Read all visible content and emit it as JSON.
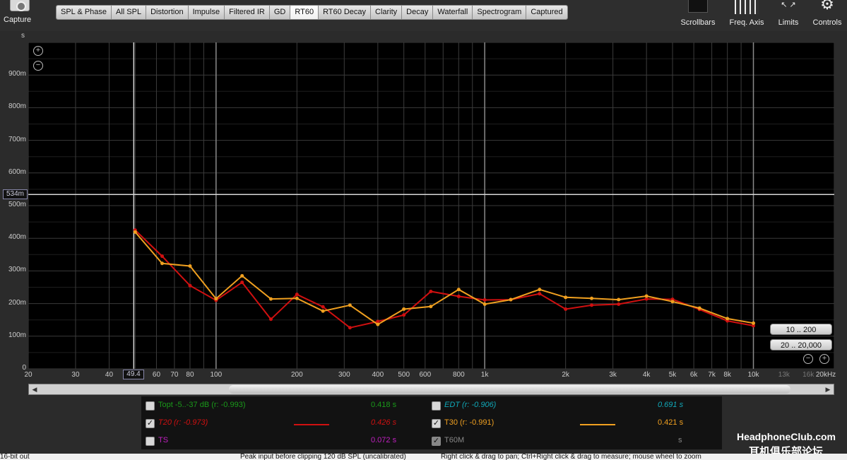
{
  "toolbar": {
    "capture_label": "Capture",
    "tabs": [
      "SPL & Phase",
      "All SPL",
      "Distortion",
      "Impulse",
      "Filtered IR",
      "GD",
      "RT60",
      "RT60 Decay",
      "Clarity",
      "Decay",
      "Waterfall",
      "Spectrogram",
      "Captured"
    ],
    "active_tab": "RT60",
    "right_tools": {
      "scrollbars": "Scrollbars",
      "freq_axis": "Freq. Axis",
      "limits": "Limits",
      "controls": "Controls"
    }
  },
  "graph": {
    "units": "s",
    "cursor_y_value": "534m",
    "cursor_x_value": "49.4",
    "range_buttons": [
      "10 .. 200",
      "20 .. 20,000"
    ],
    "x_unit_label": "20kHz"
  },
  "chart_data": {
    "type": "line",
    "xscale": "log",
    "xlim": [
      20,
      20000
    ],
    "ylim": [
      0,
      1.0
    ],
    "x_tick_labels": [
      "20",
      "30",
      "40",
      "60",
      "70",
      "80",
      "100",
      "200",
      "300",
      "400",
      "500",
      "600",
      "800",
      "1k",
      "2k",
      "3k",
      "4k",
      "5k",
      "6k",
      "7k",
      "8k",
      "10k",
      "13k",
      "16k",
      "20kHz"
    ],
    "y_tick_labels": [
      "0",
      "100m",
      "200m",
      "300m",
      "400m",
      "500m",
      "600m",
      "700m",
      "800m",
      "900m"
    ],
    "ylabel": "s",
    "grid": true,
    "series": [
      {
        "name": "T20",
        "color": "#d01010",
        "x": [
          50,
          63,
          80,
          100,
          125,
          160,
          200,
          250,
          315,
          400,
          500,
          630,
          800,
          1000,
          1250,
          1600,
          2000,
          2500,
          3150,
          4000,
          5000,
          6300,
          8000,
          10000
        ],
        "y": [
          0.425,
          0.345,
          0.255,
          0.21,
          0.265,
          0.152,
          0.228,
          0.19,
          0.126,
          0.145,
          0.165,
          0.237,
          0.222,
          0.211,
          0.212,
          0.23,
          0.183,
          0.195,
          0.198,
          0.214,
          0.213,
          0.182,
          0.147,
          0.132
        ]
      },
      {
        "name": "T30",
        "color": "#f0a020",
        "x": [
          50,
          63,
          80,
          100,
          125,
          160,
          200,
          250,
          315,
          400,
          500,
          630,
          800,
          1000,
          1250,
          1600,
          2000,
          2500,
          3150,
          4000,
          5000,
          6300,
          8000,
          10000
        ],
        "y": [
          0.419,
          0.323,
          0.315,
          0.215,
          0.285,
          0.214,
          0.216,
          0.177,
          0.195,
          0.136,
          0.183,
          0.191,
          0.243,
          0.198,
          0.212,
          0.243,
          0.219,
          0.216,
          0.212,
          0.223,
          0.206,
          0.186,
          0.154,
          0.14
        ]
      }
    ]
  },
  "legend": {
    "rows": [
      {
        "name": "Topt -5..-37 dB (r: -0.993)",
        "value": "0.418 s",
        "color": "#1a9a1a",
        "checked": false
      },
      {
        "name": "T20 (r: -0.973)",
        "value": "0.426 s",
        "color": "#d01010",
        "checked": true
      },
      {
        "name": "TS",
        "value": "0.072 s",
        "color": "#c020c0",
        "checked": false
      },
      {
        "name": "EDT (r: -0.906)",
        "value": "0.691 s",
        "color": "#10a8b8",
        "checked": false
      },
      {
        "name": "T30 (r: -0.991)",
        "value": "0.421 s",
        "color": "#f0a020",
        "checked": true
      },
      {
        "name": "T60M",
        "value": "s",
        "color": "#888888",
        "checked": true
      }
    ]
  },
  "status": {
    "bit_depth": "16-bit out",
    "peak": "Peak input before clipping 120 dB SPL (uncalibrated)",
    "hint": "Right click & drag to pan; Ctrl+Right click & drag to measure; mouse wheel to zoom"
  },
  "watermark": {
    "line1": "HeadphoneClub.com",
    "line2": "耳机俱乐部论坛"
  }
}
